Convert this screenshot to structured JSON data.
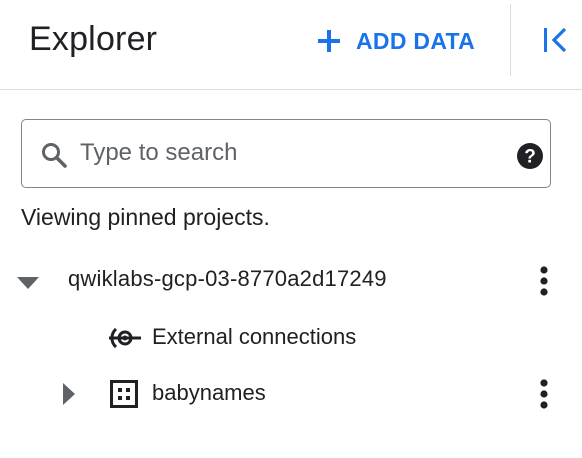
{
  "header": {
    "title": "Explorer",
    "add_data_label": "ADD DATA"
  },
  "search": {
    "placeholder": "Type to search",
    "value": ""
  },
  "status_text": "Viewing pinned projects.",
  "tree": {
    "project": {
      "name": "qwiklabs-gcp-03-8770a2d17249",
      "expanded": true
    },
    "children": [
      {
        "label": "External connections",
        "icon": "external-connections-icon"
      },
      {
        "label": "babynames",
        "icon": "dataset-icon",
        "expanded": false
      }
    ]
  },
  "colors": {
    "accent": "#1a73e8",
    "text": "#202124",
    "border": "#dadce0",
    "icon": "#202124"
  }
}
